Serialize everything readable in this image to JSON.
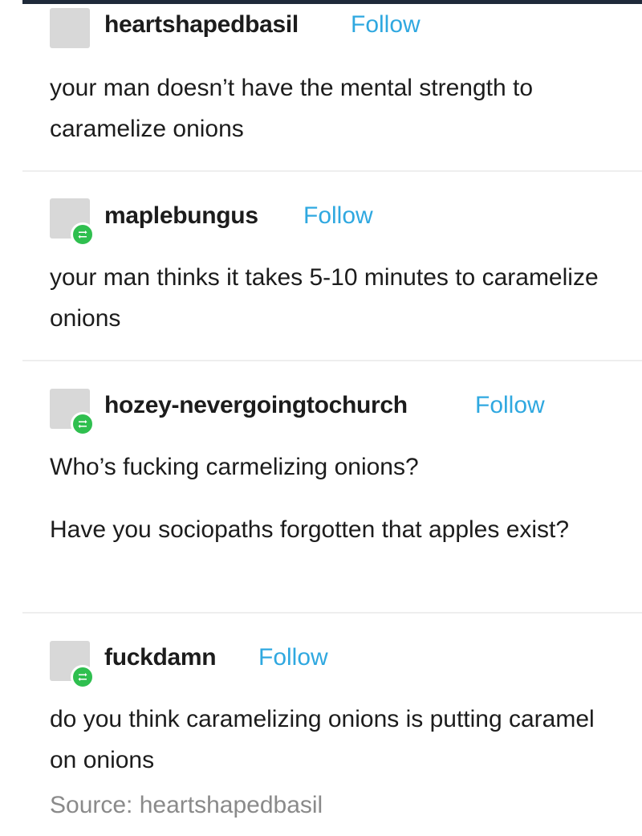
{
  "posts": [
    {
      "username": "heartshapedbasil",
      "follow_label": "Follow",
      "reblogged": false,
      "paragraphs": [
        "your man doesn’t have the mental strength to caramelize onions"
      ]
    },
    {
      "username": "maplebungus",
      "follow_label": "Follow",
      "reblogged": true,
      "paragraphs": [
        "your man thinks it takes 5-10 minutes to caramelize onions"
      ]
    },
    {
      "username": "hozey-nevergoingtochurch",
      "follow_label": "Follow",
      "reblogged": true,
      "paragraphs": [
        "Who’s fucking carmelizing onions?",
        "Have you sociopaths forgotten that apples exist?"
      ]
    },
    {
      "username": "fuckdamn",
      "follow_label": "Follow",
      "reblogged": true,
      "paragraphs": [
        "do you think caramelizing onions is putting caramel on onions"
      ]
    }
  ],
  "source": {
    "text": "Source: heartshapedbasil"
  },
  "colors": {
    "follow": "#2fa8e0",
    "reblog_badge": "#2fbf4f",
    "avatar": "#d8d8d8",
    "source_text": "#8a8a8a"
  }
}
